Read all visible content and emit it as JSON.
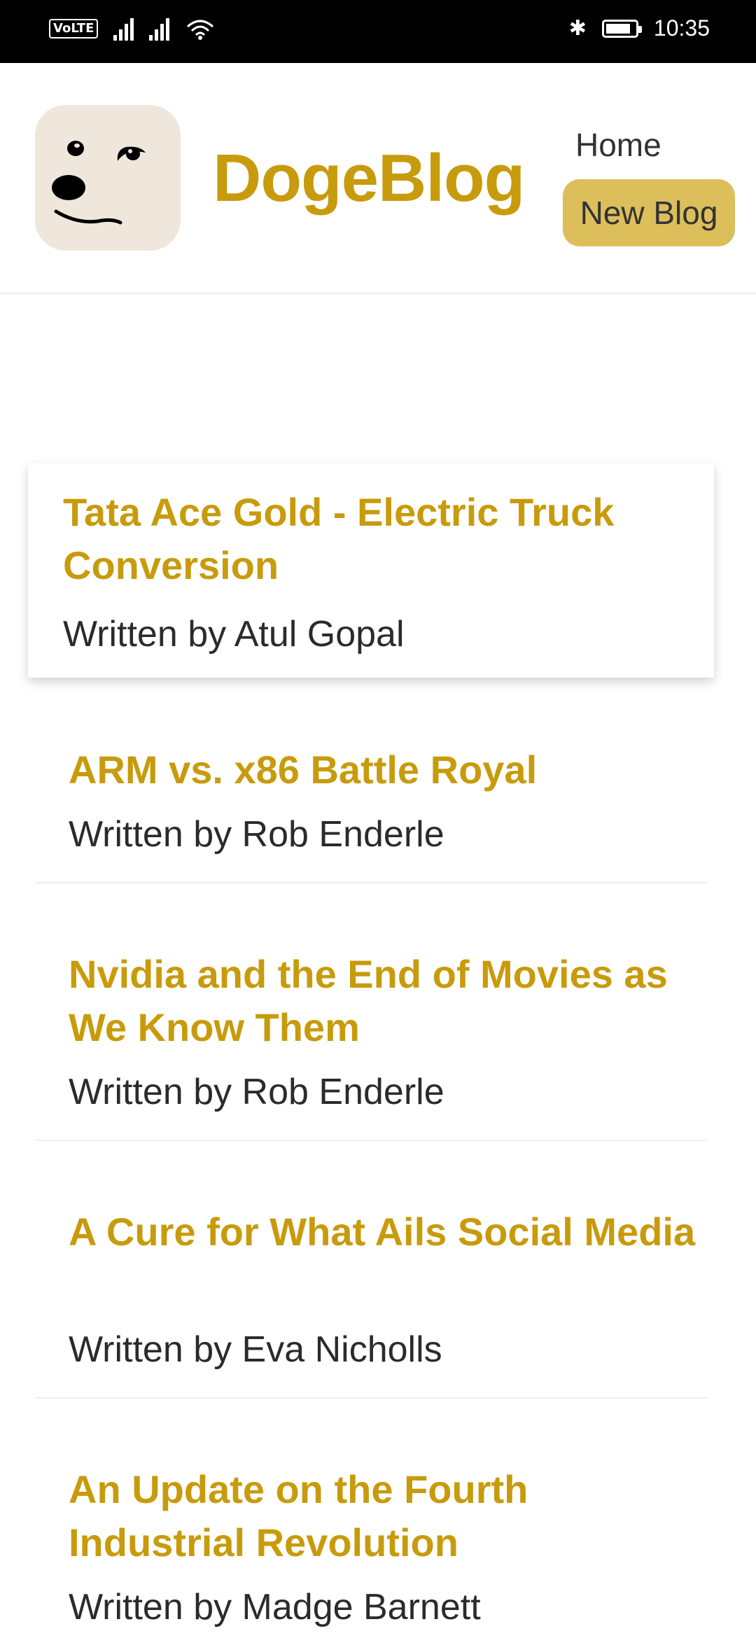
{
  "status_bar": {
    "network_badge": "VoLTE",
    "time": "10:35"
  },
  "nav": {
    "brand": "DogeBlog",
    "home_label": "Home",
    "new_blog_label": "New Blog",
    "accent_color": "#c89b0c"
  },
  "blogs": [
    {
      "title": "Tata Ace Gold - Electric Truck Conversion",
      "author": "Written by Atul Gopal"
    },
    {
      "title": "ARM vs. x86 Battle Royal",
      "author": "Written by Rob Enderle"
    },
    {
      "title": "Nvidia and the End of Movies as We Know Them",
      "author": "Written by Rob Enderle"
    },
    {
      "title": "A Cure for What Ails Social Media",
      "author": "Written by Eva Nicholls"
    },
    {
      "title": "An Update on the Fourth Industrial Revolution",
      "author": "Written by Madge Barnett"
    }
  ]
}
